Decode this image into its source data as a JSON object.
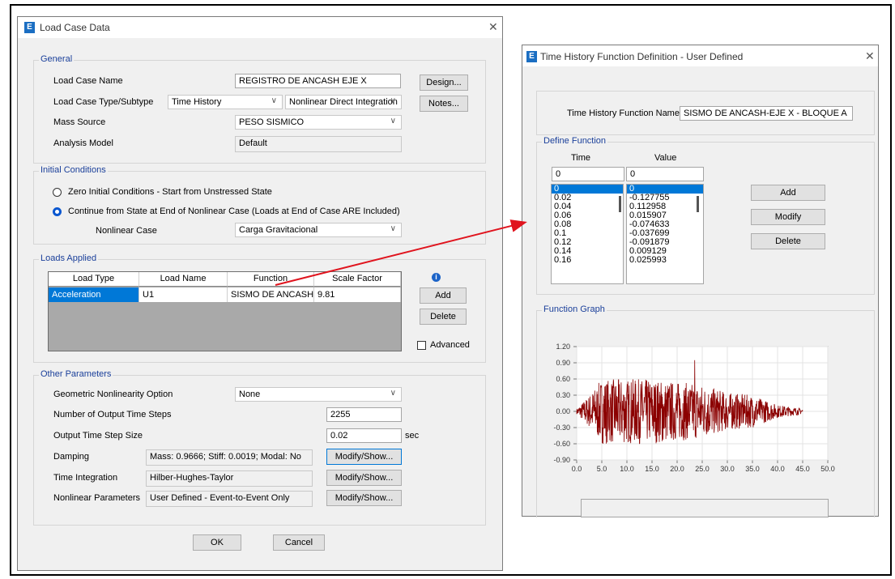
{
  "load_case": {
    "title": "Load Case Data",
    "general": {
      "group_title": "General",
      "name_label": "Load Case Name",
      "name_value": "REGISTRO DE ANCASH EJE X",
      "type_label": "Load Case Type/Subtype",
      "type_value": "Time History",
      "subtype_value": "Nonlinear Direct Integration",
      "mass_label": "Mass Source",
      "mass_value": "PESO SISMICO",
      "model_label": "Analysis Model",
      "model_value": "Default",
      "design_btn": "Design...",
      "notes_btn": "Notes..."
    },
    "initial": {
      "group_title": "Initial Conditions",
      "option_zero": "Zero Initial Conditions - Start from Unstressed State",
      "option_continue": "Continue from State at End of Nonlinear Case  (Loads at End of Case ARE Included)",
      "nonlinear_label": "Nonlinear Case",
      "nonlinear_value": "Carga Gravitacional"
    },
    "loads": {
      "group_title": "Loads Applied",
      "headers": [
        "Load Type",
        "Load Name",
        "Function",
        "Scale Factor"
      ],
      "row": [
        "Acceleration",
        "U1",
        "SISMO DE ANCASH...",
        "9.81"
      ],
      "add_btn": "Add",
      "delete_btn": "Delete",
      "advanced_label": "Advanced",
      "info_icon": "info-icon"
    },
    "other": {
      "group_title": "Other Parameters",
      "geom_label": "Geometric Nonlinearity Option",
      "geom_value": "None",
      "steps_label": "Number of Output Time Steps",
      "steps_value": "2255",
      "stepsize_label": "Output Time Step Size",
      "stepsize_value": "0.02",
      "stepsize_unit": "sec",
      "damping_label": "Damping",
      "damping_value": "Mass: 0.9666; Stiff: 0.0019; Modal: No",
      "integration_label": "Time Integration",
      "integration_value": "Hilber-Hughes-Taylor",
      "nlparams_label": "Nonlinear Parameters",
      "nlparams_value": "User Defined - Event-to-Event Only",
      "modify_btn": "Modify/Show..."
    },
    "ok_btn": "OK",
    "cancel_btn": "Cancel"
  },
  "th_function": {
    "title": "Time History Function Definition  - User Defined",
    "name_label": "Time History Function Name",
    "name_value": "SISMO DE ANCASH-EJE X - BLOQUE A",
    "define_group": "Define Function",
    "time_header": "Time",
    "value_header": "Value",
    "time_input": "0",
    "value_input": "0",
    "times": [
      "0",
      "0.02",
      "0.04",
      "0.06",
      "0.08",
      "0.1",
      "0.12",
      "0.14",
      "0.16"
    ],
    "values": [
      "0",
      "-0.127755",
      "0.112958",
      "0.015907",
      "-0.074633",
      "-0.037699",
      "-0.091879",
      "0.009129",
      "0.025993"
    ],
    "add_btn": "Add",
    "modify_btn": "Modify",
    "delete_btn": "Delete",
    "graph_group": "Function Graph"
  },
  "chart_data": {
    "type": "line",
    "title": "",
    "xlabel": "",
    "ylabel": "",
    "xlim": [
      0,
      50
    ],
    "ylim": [
      -0.9,
      1.2
    ],
    "x_ticks": [
      "0.0",
      "5.0",
      "10.0",
      "15.0",
      "20.0",
      "25.0",
      "30.0",
      "35.0",
      "40.0",
      "45.0",
      "50.0"
    ],
    "y_ticks": [
      "1.20",
      "0.90",
      "0.60",
      "0.30",
      "0.00",
      "-0.30",
      "-0.60",
      "-0.90"
    ],
    "grid": true,
    "line_color": "#8b0000",
    "x_start": 0,
    "x_end": 45,
    "peak_max": 0.95,
    "peak_min": -0.55,
    "envelope": [
      [
        0,
        0.05
      ],
      [
        2,
        0.25
      ],
      [
        5,
        0.6
      ],
      [
        10,
        0.6
      ],
      [
        15,
        0.6
      ],
      [
        20,
        0.55
      ],
      [
        25,
        0.5
      ],
      [
        30,
        0.35
      ],
      [
        35,
        0.3
      ],
      [
        40,
        0.12
      ],
      [
        45,
        0.05
      ]
    ]
  },
  "colors": {
    "accent": "#0078d7",
    "arrow": "#e0141e",
    "group_title": "#1a3f9a"
  }
}
